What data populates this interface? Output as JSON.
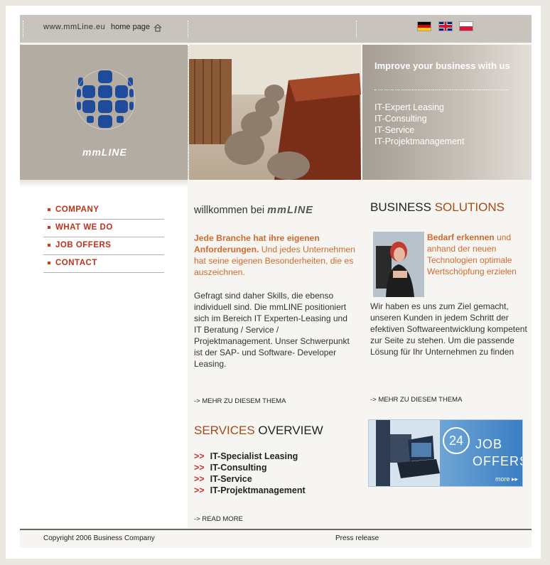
{
  "header": {
    "site_url": "www.mmLine.eu",
    "home_label": "home page",
    "flags": [
      "de-flag-icon",
      "uk-flag-icon",
      "pl-flag-icon"
    ]
  },
  "banner": {
    "logo_text": "mmLINE",
    "promo_title": "Improve your business with us",
    "promo_items": [
      "IT-Expert Leasing",
      "IT-Consulting",
      "IT-Service",
      "IT-Projektmanagement"
    ]
  },
  "nav": {
    "items": [
      "COMPANY",
      "WHAT WE DO",
      "JOB OFFERS",
      "CONTACT"
    ]
  },
  "welcome": {
    "prefix": "willkommen bei",
    "brand": "mmLINE",
    "intro_bold": "Jede Branche hat ihre eigenen Anforderungen.",
    "intro_rest": " Und jedes Unternehmen hat seine eigenen Besonderheiten, die es auszeichnen.",
    "body": "Gefragt sind daher Skills, die ebenso individuell sind. Die mmLINE positioniert sich im Bereich IT Experten-Leasing und IT Beratung / Service / Projektmanagement. Unser Schwerpunkt ist der SAP- und Software- Developer Leasing.",
    "more_link": "-> MEHR ZU DIESEM THEMA"
  },
  "services": {
    "title_accent": "SERVICES",
    "title_rest": " OVERVIEW",
    "arrow": ">>",
    "items": [
      "IT-Specialist Leasing",
      "IT-Consulting",
      "IT-Service",
      "IT-Projektmanagement"
    ],
    "read_more": "-> READ MORE"
  },
  "business": {
    "title_plain": "BUSINESS ",
    "title_accent": "SOLUTIONS",
    "lead_bold": "Bedarf erkennen",
    "lead_rest": " und anhand der neuen Technologien optimale Wertschöpfung erzielen",
    "body": "Wir haben es uns zum Ziel gemacht, unseren Kunden in jedem Schritt der efektiven Softwareentwicklung kompetent zur Seite zu stehen. Um die passende Lösung für Ihr Unternehmen zu finden",
    "more_link": "-> MEHR ZU DIESEM THEMA"
  },
  "job_banner": {
    "count": "24",
    "line1": "JOB",
    "line2": "OFFERS",
    "more": "more ▸▸"
  },
  "footer": {
    "copyright": "Copyright 2006 Business Company",
    "press": "Press release"
  },
  "colors": {
    "accent_orange": "#d06a2e",
    "nav_red": "#c0311c",
    "topbar": "#c8c3bc",
    "logo_blue": "#1f4c9a"
  }
}
